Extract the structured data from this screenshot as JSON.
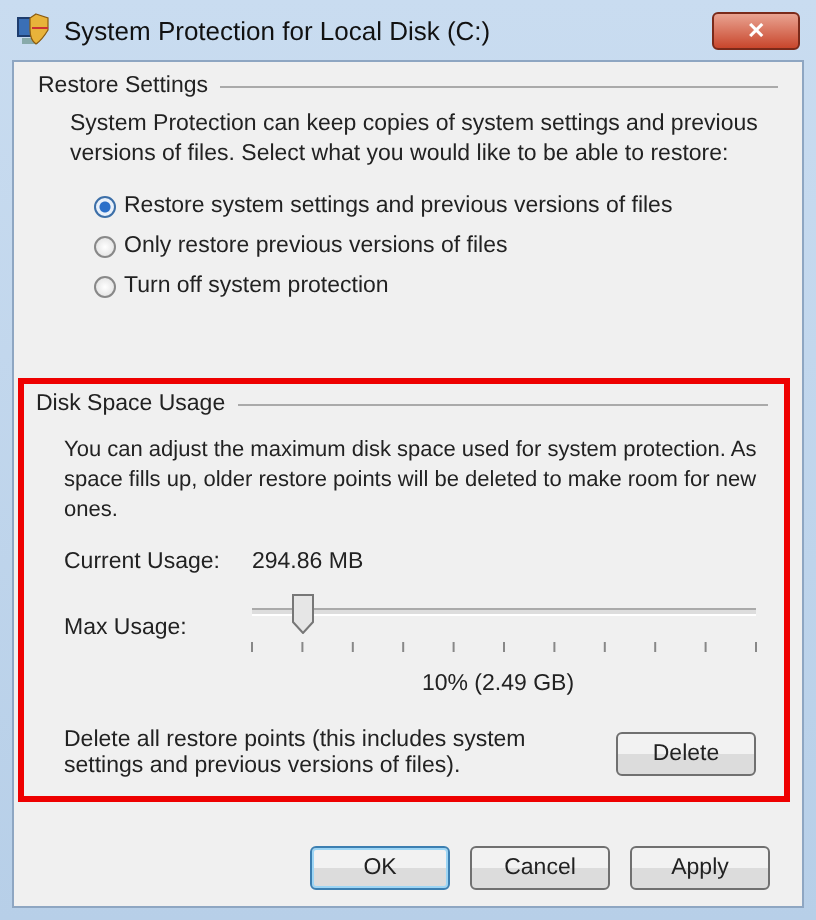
{
  "window": {
    "title": "System Protection for Local Disk (C:)",
    "close_label": "✕"
  },
  "restore_settings": {
    "title": "Restore Settings",
    "description": "System Protection can keep copies of system settings and previous versions of files. Select what you would like to be able to restore:",
    "options": [
      {
        "label": "Restore system settings and previous versions of files",
        "selected": true
      },
      {
        "label": "Only restore previous versions of files",
        "selected": false
      },
      {
        "label": "Turn off system protection",
        "selected": false
      }
    ]
  },
  "disk_space": {
    "title": "Disk Space Usage",
    "highlighted": true,
    "description": "You can adjust the maximum disk space used for system protection. As space fills up, older restore points will be deleted to make room for new ones.",
    "current_usage_label": "Current Usage:",
    "current_usage": "294.86 MB",
    "max_usage_label": "Max Usage:",
    "max_usage": {
      "level": 0.1
    },
    "max_usage_reading": "10% (2.49 GB)",
    "delete_text": "Delete all restore points (this includes system settings and previous versions of files).",
    "delete_button": "Delete"
  },
  "buttons": [
    {
      "label": "OK",
      "default": true
    },
    {
      "label": "Cancel",
      "default": false
    },
    {
      "label": "Apply",
      "default": false
    }
  ]
}
